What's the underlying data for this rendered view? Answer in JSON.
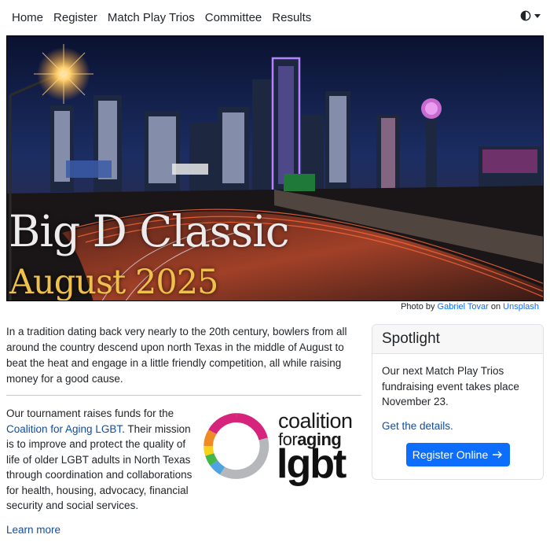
{
  "nav": {
    "items": [
      {
        "label": "Home"
      },
      {
        "label": "Register"
      },
      {
        "label": "Match Play Trios"
      },
      {
        "label": "Committee"
      },
      {
        "label": "Results"
      }
    ],
    "theme_icon": "contrast-half-circle-icon"
  },
  "hero": {
    "title": "Big D Classic",
    "subtitle": "August 2025",
    "title_color": "#ececec",
    "subtitle_color": "#f0c14a"
  },
  "credit": {
    "prefix": "Photo by",
    "author": "Gabriel Tovar",
    "on": "on",
    "site": "Unsplash"
  },
  "intro": {
    "text": "In a tradition dating back very nearly to the 20th century, bowlers from all around the country descend upon north Texas in the middle of August to beat the heat and engage in a little friendly competition, all while raising money for a good cause."
  },
  "funds": {
    "pre": "Our tournament raises funds for the",
    "link": "Coalition for Aging LGBT",
    "post": ". Their mission is to improve and protect the quality of life of older LGBT adults in North Texas through coordination and collaborations for health, housing, advocacy, financial security and social services.",
    "learn_more": "Learn more"
  },
  "logo": {
    "line1": "coalition",
    "line2a": "for",
    "line2b": "aging",
    "line3": "lgbt"
  },
  "spotlight": {
    "header": "Spotlight",
    "text": "Our next Match Play Trios fundraising event takes place November 23.",
    "link": "Get the details.",
    "button": "Register Online",
    "button_icon": "arrow-right-icon",
    "button_color": "#0d6efd"
  }
}
